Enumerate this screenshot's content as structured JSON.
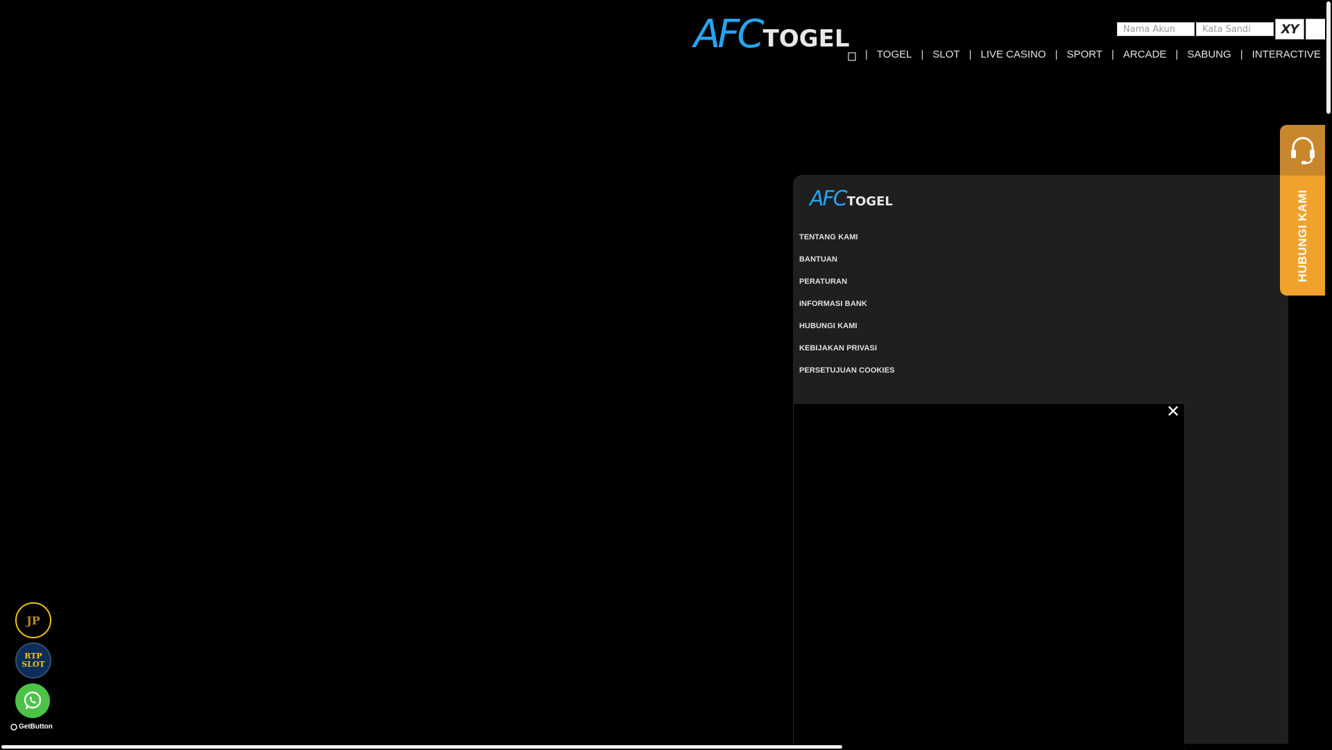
{
  "header": {
    "logo": {
      "part1": "AFC",
      "part2": "TOGEL"
    },
    "login": {
      "username_placeholder": "Nama Akun",
      "password_placeholder": "Kata Sandi",
      "captcha_text": "XY"
    },
    "nav": {
      "home_icon": "home-icon",
      "separator": "|",
      "items": [
        "TOGEL",
        "SLOT",
        "LIVE CASINO",
        "SPORT",
        "ARCADE",
        "SABUNG",
        "INTERACTIVE"
      ]
    }
  },
  "footer": {
    "logo": {
      "part1": "AFC",
      "part2": "TOGEL"
    },
    "links": [
      "TENTANG KAMI",
      "BANTUAN",
      "PERATURAN",
      "INFORMASI BANK",
      "HUBUNGI KAMI",
      "KEBIJAKAN PRIVASI",
      "PERSETUJUAN COOKIES"
    ]
  },
  "popup": {
    "close_symbol": "✕"
  },
  "contact_tab": {
    "label": "HUBUNGI KAMI",
    "icon": "headset-icon"
  },
  "floating": {
    "jp_label": "JP",
    "rtp_line1": "RTP",
    "rtp_line2": "SLOT",
    "whatsapp_icon": "whatsapp-icon",
    "getbutton_label": "GetButton"
  },
  "colors": {
    "background": "#000000",
    "brand_blue": "#26a4f0",
    "footer_bg": "#1f1f1f",
    "contact_orange": "#f0a22c",
    "contact_orange_dark": "#c8872c",
    "whatsapp_green": "#4dc247",
    "jp_gold": "#f3c313"
  }
}
